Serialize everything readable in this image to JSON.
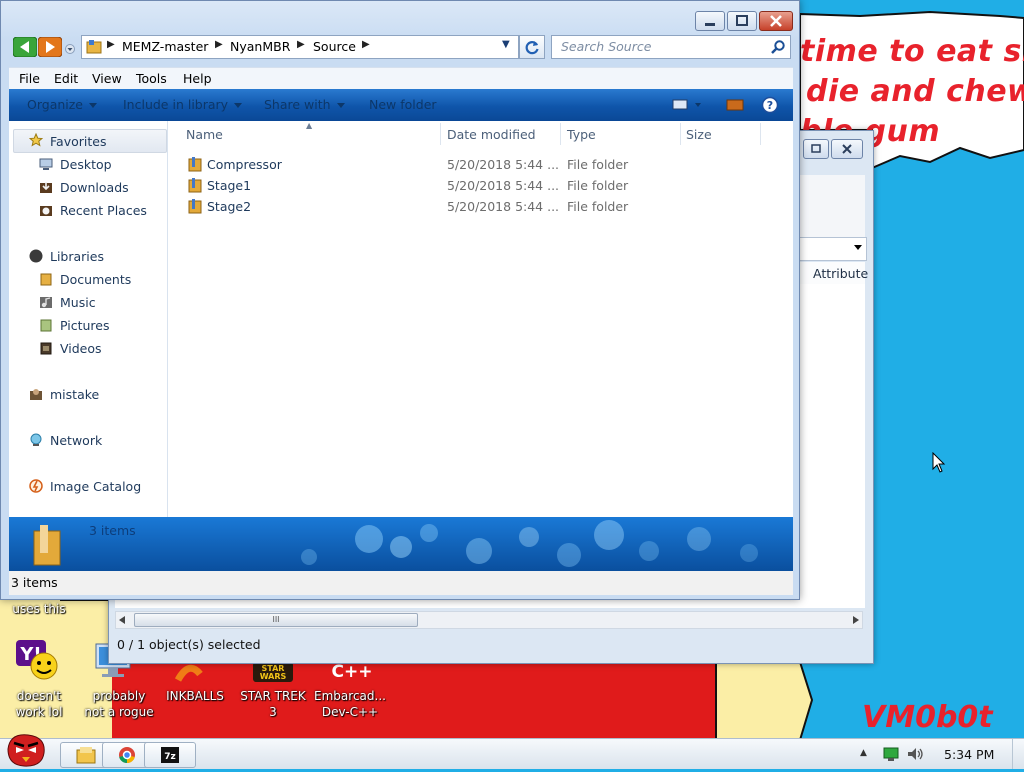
{
  "wallpaper": {
    "meme_lines": [
      "time to eat shit",
      "die and chew",
      "ble gum"
    ],
    "signature": "VM0b0t",
    "colors": {
      "sky": "#20aee6",
      "red": "#e8222c",
      "cream": "#fbeea6"
    }
  },
  "desktop_icons": [
    {
      "label_lines": [
        "uses this"
      ],
      "icon": "partial-icon"
    },
    {
      "label_lines": [
        "doesn't",
        "work lol"
      ],
      "icon": "yahoo-messenger-icon"
    },
    {
      "label_lines": [
        "probably",
        "not a rogue"
      ],
      "icon": "computer-icon"
    },
    {
      "label_lines": [
        "INKBALLS"
      ],
      "icon": "inkball-icon"
    },
    {
      "label_lines": [
        "STAR TREK",
        "3"
      ],
      "icon": "star-wars-icon"
    },
    {
      "label_lines": [
        "Embarcad...",
        "Dev-C++"
      ],
      "icon": "dev-cpp-icon"
    }
  ],
  "explorer": {
    "breadcrumb": [
      "MEMZ-master",
      "NyanMBR",
      "Source"
    ],
    "search_placeholder": "Search Source",
    "menu": [
      "File",
      "Edit",
      "View",
      "Tools",
      "Help"
    ],
    "commands": [
      {
        "label": "Organize",
        "has_dropdown": true
      },
      {
        "label": "Include in library",
        "has_dropdown": true
      },
      {
        "label": "Share with",
        "has_dropdown": true
      },
      {
        "label": "New folder",
        "has_dropdown": false
      }
    ],
    "nav": {
      "favorites": {
        "label": "Favorites",
        "items": [
          "Desktop",
          "Downloads",
          "Recent Places"
        ]
      },
      "libraries": {
        "label": "Libraries",
        "items": [
          "Documents",
          "Music",
          "Pictures",
          "Videos"
        ]
      },
      "others": [
        "mistake",
        "Network",
        "Image Catalog"
      ]
    },
    "columns": [
      "Name",
      "Date modified",
      "Type",
      "Size"
    ],
    "files": [
      {
        "name": "Compressor",
        "date": "5/20/2018 5:44 ...",
        "type": "File folder",
        "size": ""
      },
      {
        "name": "Stage1",
        "date": "5/20/2018 5:44 ...",
        "type": "File folder",
        "size": ""
      },
      {
        "name": "Stage2",
        "date": "5/20/2018 5:44 ...",
        "type": "File folder",
        "size": ""
      }
    ],
    "details_count": "3 items",
    "status_bar": "3 items"
  },
  "back_window": {
    "column_header": "Attribute",
    "selection_status": "0 / 1 object(s) selected",
    "scroll_thumb_glyph": "III"
  },
  "taskbar": {
    "clock": "5:34 PM",
    "pinned": [
      "windows-explorer-icon",
      "chrome-icon",
      "7zip-icon"
    ]
  }
}
